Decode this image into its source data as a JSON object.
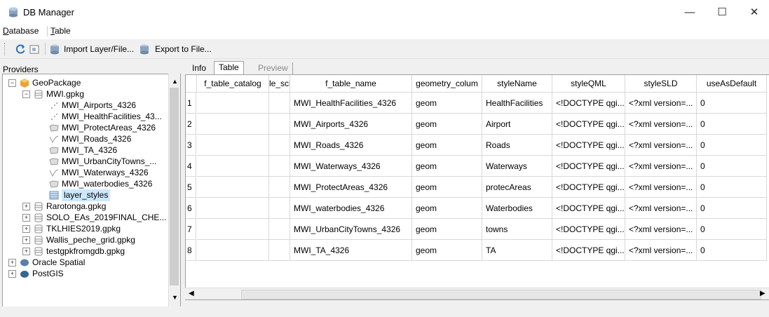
{
  "window": {
    "title": "DB Manager",
    "min": "—",
    "max": "☐",
    "close": "✕"
  },
  "menu": {
    "database": "Database",
    "table": "Table"
  },
  "toolbar": {
    "import": "Import Layer/File...",
    "export": "Export to File..."
  },
  "providers": {
    "label": "Providers",
    "items": [
      {
        "label": "GeoPackage"
      },
      {
        "label": "MWI.gpkg"
      },
      {
        "label": "MWI_Airports_4326"
      },
      {
        "label": "MWI_HealthFacilities_43..."
      },
      {
        "label": "MWI_ProtectAreas_4326"
      },
      {
        "label": "MWI_Roads_4326"
      },
      {
        "label": "MWI_TA_4326"
      },
      {
        "label": "MWI_UrbanCityTowns_..."
      },
      {
        "label": "MWI_Waterways_4326"
      },
      {
        "label": "MWI_waterbodies_4326"
      },
      {
        "label": "layer_styles"
      },
      {
        "label": "Rarotonga.gpkg"
      },
      {
        "label": "SOLO_EAs_2019FINAL_CHE..."
      },
      {
        "label": "TKLHIES2019.gpkg"
      },
      {
        "label": "Wallis_peche_grid.gpkg"
      },
      {
        "label": "testgpkfromgdb.gpkg"
      },
      {
        "label": "Oracle Spatial"
      },
      {
        "label": "PostGIS"
      }
    ]
  },
  "tabs": {
    "info": "Info",
    "table": "Table",
    "preview": "Preview"
  },
  "grid": {
    "columns": [
      "f_table_catalog",
      "le_sch",
      "f_table_name",
      "geometry_colum",
      "styleName",
      "styleQML",
      "styleSLD",
      "useAsDefault"
    ],
    "rows": [
      {
        "n": "1",
        "c": [
          "",
          "",
          "MWI_HealthFacilities_4326",
          "geom",
          "HealthFacilities",
          "<!DOCTYPE qgi...",
          "<?xml version=...",
          "0"
        ]
      },
      {
        "n": "2",
        "c": [
          "",
          "",
          "MWI_Airports_4326",
          "geom",
          "Airport",
          "<!DOCTYPE qgi...",
          "<?xml version=...",
          "0"
        ]
      },
      {
        "n": "3",
        "c": [
          "",
          "",
          "MWI_Roads_4326",
          "geom",
          "Roads",
          "<!DOCTYPE qgi...",
          "<?xml version=...",
          "0"
        ]
      },
      {
        "n": "4",
        "c": [
          "",
          "",
          "MWI_Waterways_4326",
          "geom",
          "Waterways",
          "<!DOCTYPE qgi...",
          "<?xml version=...",
          "0"
        ]
      },
      {
        "n": "5",
        "c": [
          "",
          "",
          "MWI_ProtectAreas_4326",
          "geom",
          "protecAreas",
          "<!DOCTYPE qgi...",
          "<?xml version=...",
          "0"
        ]
      },
      {
        "n": "6",
        "c": [
          "",
          "",
          "MWI_waterbodies_4326",
          "geom",
          "Waterbodies",
          "<!DOCTYPE qgi...",
          "<?xml version=...",
          "0"
        ]
      },
      {
        "n": "7",
        "c": [
          "",
          "",
          "MWI_UrbanCityTowns_4326",
          "geom",
          "towns",
          "<!DOCTYPE qgi...",
          "<?xml version=...",
          "0"
        ]
      },
      {
        "n": "8",
        "c": [
          "",
          "",
          "MWI_TA_4326",
          "geom",
          "TA",
          "<!DOCTYPE qgi...",
          "<?xml version=...",
          "0"
        ]
      }
    ]
  },
  "colors": {
    "selection": "#cce8ff",
    "db_icon": "#7f9fbf",
    "geopackage": "#e8a33a"
  }
}
